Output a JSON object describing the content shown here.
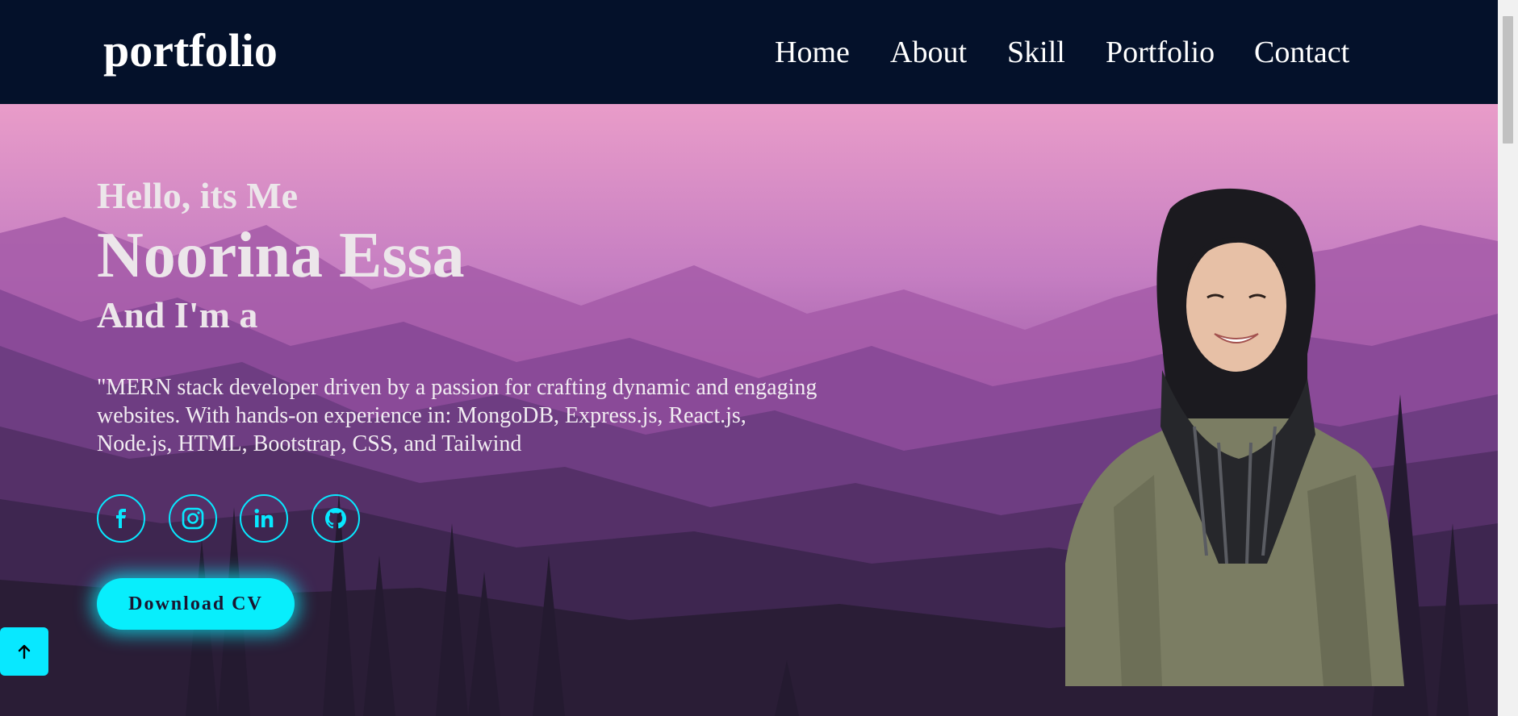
{
  "nav": {
    "logo": "portfolio",
    "links": [
      "Home",
      "About",
      "Skill",
      "Portfolio",
      "Contact"
    ]
  },
  "hero": {
    "greeting": "Hello, its Me",
    "name": "Noorina Essa",
    "role_prefix": "And I'm a",
    "bio": "\"MERN stack developer driven by a passion for crafting dynamic and engaging websites. With hands-on experience in: MongoDB, Express.js, React.js, Node.js, HTML, Bootstrap, CSS, and Tailwind",
    "socials": [
      "facebook-icon",
      "instagram-icon",
      "linkedin-icon",
      "github-icon"
    ],
    "cv_button": "Download CV"
  },
  "scroll_top_icon": "arrow-up-icon",
  "colors": {
    "navbar": "#04112a",
    "accent": "#08eefc",
    "text_light": "#ece6ea"
  }
}
